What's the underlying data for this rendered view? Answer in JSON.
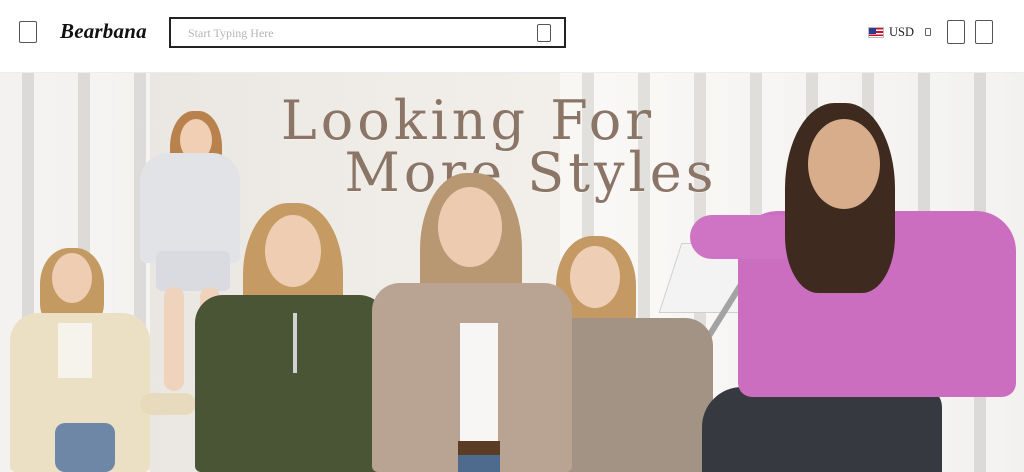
{
  "header": {
    "brand": "Bearbana",
    "search_placeholder": "Start Typing Here",
    "currency": "USD",
    "icons": {
      "menu": "menu-icon",
      "search": "search-icon",
      "flag": "us-flag-icon",
      "caret": "caret-down-icon",
      "account": "account-icon",
      "cart": "cart-icon"
    }
  },
  "hero": {
    "headline_line1": "Looking For",
    "headline_line2": "More  Styles"
  },
  "colors": {
    "headline": "#8a7566",
    "header_background": "#ffffff",
    "search_border": "#222222"
  }
}
